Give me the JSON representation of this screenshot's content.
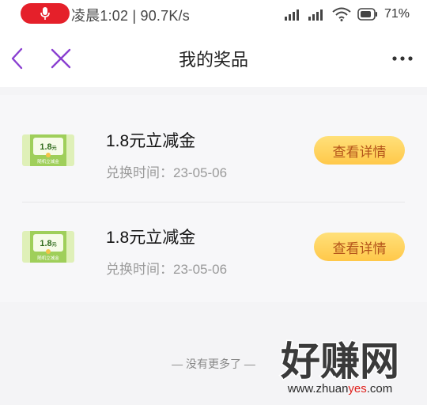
{
  "statusbar": {
    "status_text": "凌晨1:02 | 90.7K/s",
    "battery_text": "71%",
    "mic_icon": "microphone-icon"
  },
  "header": {
    "title": "我的奖品",
    "back_icon": "chevron-left-icon",
    "close_icon": "close-icon",
    "more_icon": "more-dots-icon"
  },
  "prizes": [
    {
      "name": "1.8元立减金",
      "date": "兑换时间：23-05-06",
      "thumb_amount": "1.8",
      "thumb_unit": "元",
      "thumb_caption": "随机立减金",
      "button_label": "查看详情"
    },
    {
      "name": "1.8元立减金",
      "date": "兑换时间：23-05-06",
      "thumb_amount": "1.8",
      "thumb_unit": "元",
      "thumb_caption": "随机立减金",
      "button_label": "查看详情"
    }
  ],
  "footer": {
    "no_more": "— 没有更多了 —"
  },
  "watermark": {
    "title": "好赚网",
    "url_prefix": "www.zhuan",
    "url_highlight": "yes",
    "url_suffix": ".com"
  },
  "colors": {
    "accent_purple": "#8a3fd1",
    "button_gradient_top": "#ffe07a",
    "button_gradient_bottom": "#ffc84a",
    "button_text": "#b4541a",
    "mic_red": "#e5202a"
  }
}
